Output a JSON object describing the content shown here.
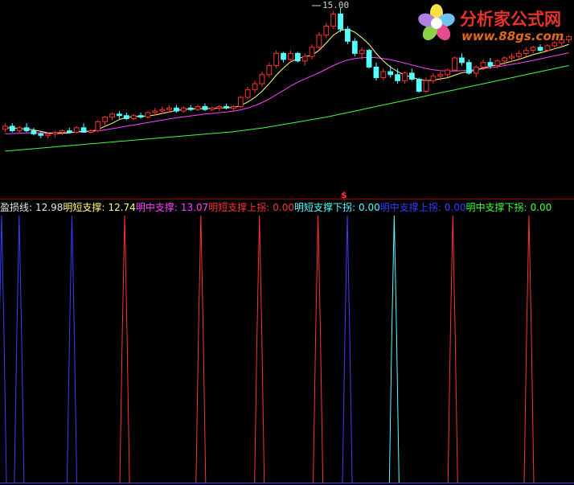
{
  "chart_data": [
    {
      "type": "candlestick",
      "peak_label": "15.00",
      "signal_marker": "$",
      "colors": {
        "up": "#ff3232",
        "down": "#54ffff",
        "ma_short": "#ffff80",
        "ma_mid": "#ff40ff",
        "ma_long": "#40ff40"
      },
      "price_range": [
        9.8,
        15.1
      ],
      "candles": [
        [
          11.0,
          11.2,
          10.9,
          11.1
        ],
        [
          11.1,
          11.2,
          10.9,
          10.95
        ],
        [
          10.95,
          11.1,
          10.85,
          11.05
        ],
        [
          11.05,
          11.2,
          10.9,
          10.95
        ],
        [
          10.95,
          11.05,
          10.8,
          10.85
        ],
        [
          10.85,
          10.95,
          10.7,
          10.8
        ],
        [
          10.8,
          10.9,
          10.7,
          10.85
        ],
        [
          10.85,
          10.95,
          10.75,
          10.9
        ],
        [
          10.9,
          11.0,
          10.8,
          10.95
        ],
        [
          10.95,
          11.05,
          10.85,
          10.9
        ],
        [
          10.9,
          11.1,
          10.85,
          11.05
        ],
        [
          11.05,
          11.2,
          10.95,
          10.9
        ],
        [
          10.9,
          11.0,
          10.85,
          10.95
        ],
        [
          10.95,
          11.3,
          10.9,
          11.25
        ],
        [
          11.25,
          11.45,
          11.1,
          11.4
        ],
        [
          11.4,
          11.55,
          11.3,
          11.5
        ],
        [
          11.5,
          11.6,
          11.35,
          11.45
        ],
        [
          11.45,
          11.55,
          11.3,
          11.35
        ],
        [
          11.35,
          11.5,
          11.3,
          11.45
        ],
        [
          11.45,
          11.55,
          11.35,
          11.4
        ],
        [
          11.4,
          11.6,
          11.35,
          11.55
        ],
        [
          11.55,
          11.7,
          11.45,
          11.6
        ],
        [
          11.6,
          11.75,
          11.5,
          11.65
        ],
        [
          11.65,
          11.8,
          11.55,
          11.7
        ],
        [
          11.7,
          11.8,
          11.55,
          11.6
        ],
        [
          11.6,
          11.75,
          11.55,
          11.7
        ],
        [
          11.7,
          11.8,
          11.6,
          11.65
        ],
        [
          11.65,
          11.8,
          11.6,
          11.75
        ],
        [
          11.75,
          11.85,
          11.6,
          11.65
        ],
        [
          11.65,
          11.75,
          11.6,
          11.7
        ],
        [
          11.7,
          11.8,
          11.6,
          11.75
        ],
        [
          11.75,
          11.85,
          11.65,
          11.7
        ],
        [
          11.7,
          11.8,
          11.6,
          11.75
        ],
        [
          11.75,
          12.1,
          11.7,
          12.05
        ],
        [
          12.05,
          12.4,
          12.0,
          12.3
        ],
        [
          12.3,
          12.6,
          12.2,
          12.5
        ],
        [
          12.5,
          12.9,
          12.4,
          12.8
        ],
        [
          12.8,
          13.2,
          12.7,
          13.1
        ],
        [
          13.1,
          13.6,
          13.0,
          13.5
        ],
        [
          13.5,
          13.55,
          13.2,
          13.3
        ],
        [
          13.3,
          13.6,
          13.2,
          13.5
        ],
        [
          13.5,
          13.55,
          13.2,
          13.25
        ],
        [
          13.25,
          13.5,
          13.1,
          13.4
        ],
        [
          13.4,
          13.8,
          13.3,
          13.7
        ],
        [
          13.7,
          14.2,
          13.6,
          14.1
        ],
        [
          14.1,
          14.5,
          14.0,
          14.4
        ],
        [
          14.4,
          14.9,
          14.3,
          14.8
        ],
        [
          14.8,
          15.0,
          14.2,
          14.3
        ],
        [
          14.3,
          14.4,
          13.8,
          13.9
        ],
        [
          13.9,
          14.0,
          13.4,
          13.5
        ],
        [
          13.5,
          13.7,
          13.3,
          13.6
        ],
        [
          13.6,
          13.65,
          13.0,
          13.05
        ],
        [
          13.05,
          13.2,
          12.6,
          12.7
        ],
        [
          12.7,
          13.0,
          12.6,
          12.9
        ],
        [
          12.9,
          13.1,
          12.7,
          12.8
        ],
        [
          12.8,
          13.0,
          12.5,
          12.6
        ],
        [
          12.6,
          12.9,
          12.5,
          12.85
        ],
        [
          12.85,
          13.0,
          12.6,
          12.65
        ],
        [
          12.65,
          12.7,
          12.2,
          12.25
        ],
        [
          12.25,
          12.7,
          12.2,
          12.6
        ],
        [
          12.6,
          12.85,
          12.5,
          12.75
        ],
        [
          12.75,
          12.9,
          12.6,
          12.8
        ],
        [
          12.8,
          13.0,
          12.7,
          12.95
        ],
        [
          12.95,
          13.4,
          12.9,
          13.35
        ],
        [
          13.35,
          13.5,
          13.1,
          13.2
        ],
        [
          13.2,
          13.3,
          12.8,
          12.85
        ],
        [
          12.85,
          13.1,
          12.7,
          13.05
        ],
        [
          13.05,
          13.3,
          12.95,
          13.2
        ],
        [
          13.2,
          13.35,
          13.0,
          13.1
        ],
        [
          13.1,
          13.3,
          13.0,
          13.25
        ],
        [
          13.25,
          13.4,
          13.1,
          13.35
        ],
        [
          13.35,
          13.5,
          13.2,
          13.4
        ],
        [
          13.4,
          13.6,
          13.3,
          13.5
        ],
        [
          13.5,
          13.7,
          13.4,
          13.6
        ],
        [
          13.6,
          13.75,
          13.5,
          13.7
        ],
        [
          13.7,
          13.8,
          13.55,
          13.6
        ],
        [
          13.6,
          13.8,
          13.55,
          13.75
        ],
        [
          13.75,
          13.9,
          13.65,
          13.85
        ],
        [
          13.85,
          14.0,
          13.75,
          13.95
        ],
        [
          13.95,
          14.1,
          13.85,
          14.05
        ]
      ],
      "ma_short": [
        11.05,
        11.04,
        11.02,
        11.01,
        10.98,
        10.93,
        10.88,
        10.86,
        10.87,
        10.88,
        10.92,
        10.94,
        10.93,
        10.99,
        11.1,
        11.2,
        11.32,
        11.39,
        11.42,
        11.43,
        11.44,
        11.47,
        11.52,
        11.57,
        11.62,
        11.65,
        11.67,
        11.68,
        11.69,
        11.69,
        11.7,
        11.71,
        11.71,
        11.78,
        11.9,
        12.05,
        12.25,
        12.5,
        12.78,
        13.02,
        13.22,
        13.33,
        13.39,
        13.44,
        13.6,
        13.84,
        14.1,
        14.26,
        14.3,
        14.2,
        14.02,
        13.8,
        13.5,
        13.25,
        13.05,
        12.9,
        12.78,
        12.72,
        12.64,
        12.6,
        12.62,
        12.66,
        12.7,
        12.78,
        12.86,
        12.9,
        12.95,
        13.02,
        13.08,
        13.12,
        13.18,
        13.24,
        13.3,
        13.38,
        13.46,
        13.52,
        13.58,
        13.65,
        13.72,
        13.8
      ],
      "ma_mid": [
        10.85,
        10.86,
        10.87,
        10.88,
        10.88,
        10.88,
        10.88,
        10.88,
        10.89,
        10.9,
        10.91,
        10.92,
        10.93,
        10.95,
        10.98,
        11.02,
        11.06,
        11.1,
        11.14,
        11.18,
        11.22,
        11.26,
        11.3,
        11.34,
        11.38,
        11.41,
        11.44,
        11.47,
        11.5,
        11.52,
        11.55,
        11.57,
        11.6,
        11.64,
        11.7,
        11.78,
        11.88,
        12.0,
        12.14,
        12.28,
        12.42,
        12.55,
        12.66,
        12.76,
        12.86,
        12.98,
        13.1,
        13.2,
        13.28,
        13.33,
        13.36,
        13.37,
        13.36,
        13.33,
        13.29,
        13.24,
        13.18,
        13.12,
        13.06,
        13.0,
        12.96,
        12.93,
        12.92,
        12.92,
        12.93,
        12.95,
        12.97,
        13.0,
        13.03,
        13.06,
        13.1,
        13.14,
        13.18,
        13.22,
        13.27,
        13.32,
        13.37,
        13.42,
        13.47,
        13.52
      ],
      "ma_long": [
        10.28,
        10.3,
        10.32,
        10.34,
        10.36,
        10.38,
        10.4,
        10.42,
        10.44,
        10.46,
        10.48,
        10.5,
        10.52,
        10.54,
        10.56,
        10.58,
        10.6,
        10.62,
        10.64,
        10.66,
        10.68,
        10.7,
        10.72,
        10.74,
        10.76,
        10.78,
        10.8,
        10.82,
        10.84,
        10.86,
        10.88,
        10.9,
        10.92,
        10.95,
        10.98,
        11.01,
        11.04,
        11.08,
        11.12,
        11.16,
        11.2,
        11.24,
        11.28,
        11.32,
        11.36,
        11.4,
        11.45,
        11.5,
        11.55,
        11.6,
        11.65,
        11.7,
        11.75,
        11.8,
        11.85,
        11.9,
        11.95,
        12.0,
        12.05,
        12.1,
        12.15,
        12.2,
        12.25,
        12.3,
        12.35,
        12.4,
        12.45,
        12.5,
        12.55,
        12.6,
        12.65,
        12.7,
        12.75,
        12.8,
        12.85,
        12.9,
        12.95,
        13.0,
        13.05,
        13.1
      ]
    },
    {
      "type": "indicator-spikes",
      "legend": [
        {
          "label": "盈损线:",
          "value": "12.98",
          "color": "#e6e6e6"
        },
        {
          "label": "明短支撑:",
          "value": "12.74",
          "color": "#ffff80"
        },
        {
          "label": "明中支撑:",
          "value": "13.07",
          "color": "#ff40ff"
        },
        {
          "label": "明短支撑上拐:",
          "value": "0.00",
          "color": "#ff3232"
        },
        {
          "label": "明短支撑下拐:",
          "value": "0.00",
          "color": "#54ffff"
        },
        {
          "label": "明中支撑上拐:",
          "value": "0.00",
          "color": "#3a3aff"
        },
        {
          "label": "明中支撑下拐:",
          "value": "0.00",
          "color": "#40ff40"
        }
      ],
      "spikes": [
        {
          "bar": 0,
          "series": "明中支撑上拐",
          "color": "#3a3aff"
        },
        {
          "bar": 3,
          "series": "明中支撑上拐",
          "color": "#3a3aff"
        },
        {
          "bar": 12,
          "series": "明中支撑上拐",
          "color": "#3a3aff"
        },
        {
          "bar": 21,
          "series": "明短支撑上拐",
          "color": "#ff3232"
        },
        {
          "bar": 34,
          "series": "明短支撑上拐",
          "color": "#ff3232"
        },
        {
          "bar": 44,
          "series": "明短支撑上拐",
          "color": "#ff3232"
        },
        {
          "bar": 54,
          "series": "明短支撑上拐",
          "color": "#ff3232"
        },
        {
          "bar": 59,
          "series": "明中支撑上拐",
          "color": "#3a3aff"
        },
        {
          "bar": 67,
          "series": "明短支撑下拐",
          "color": "#54ffff"
        },
        {
          "bar": 77,
          "series": "明短支撑上拐",
          "color": "#ff3232"
        },
        {
          "bar": 90,
          "series": "明短支撑上拐",
          "color": "#ff3232"
        }
      ]
    }
  ],
  "watermark": {
    "site_name": "分析家公式网",
    "site_url": "www.88gs.com"
  }
}
